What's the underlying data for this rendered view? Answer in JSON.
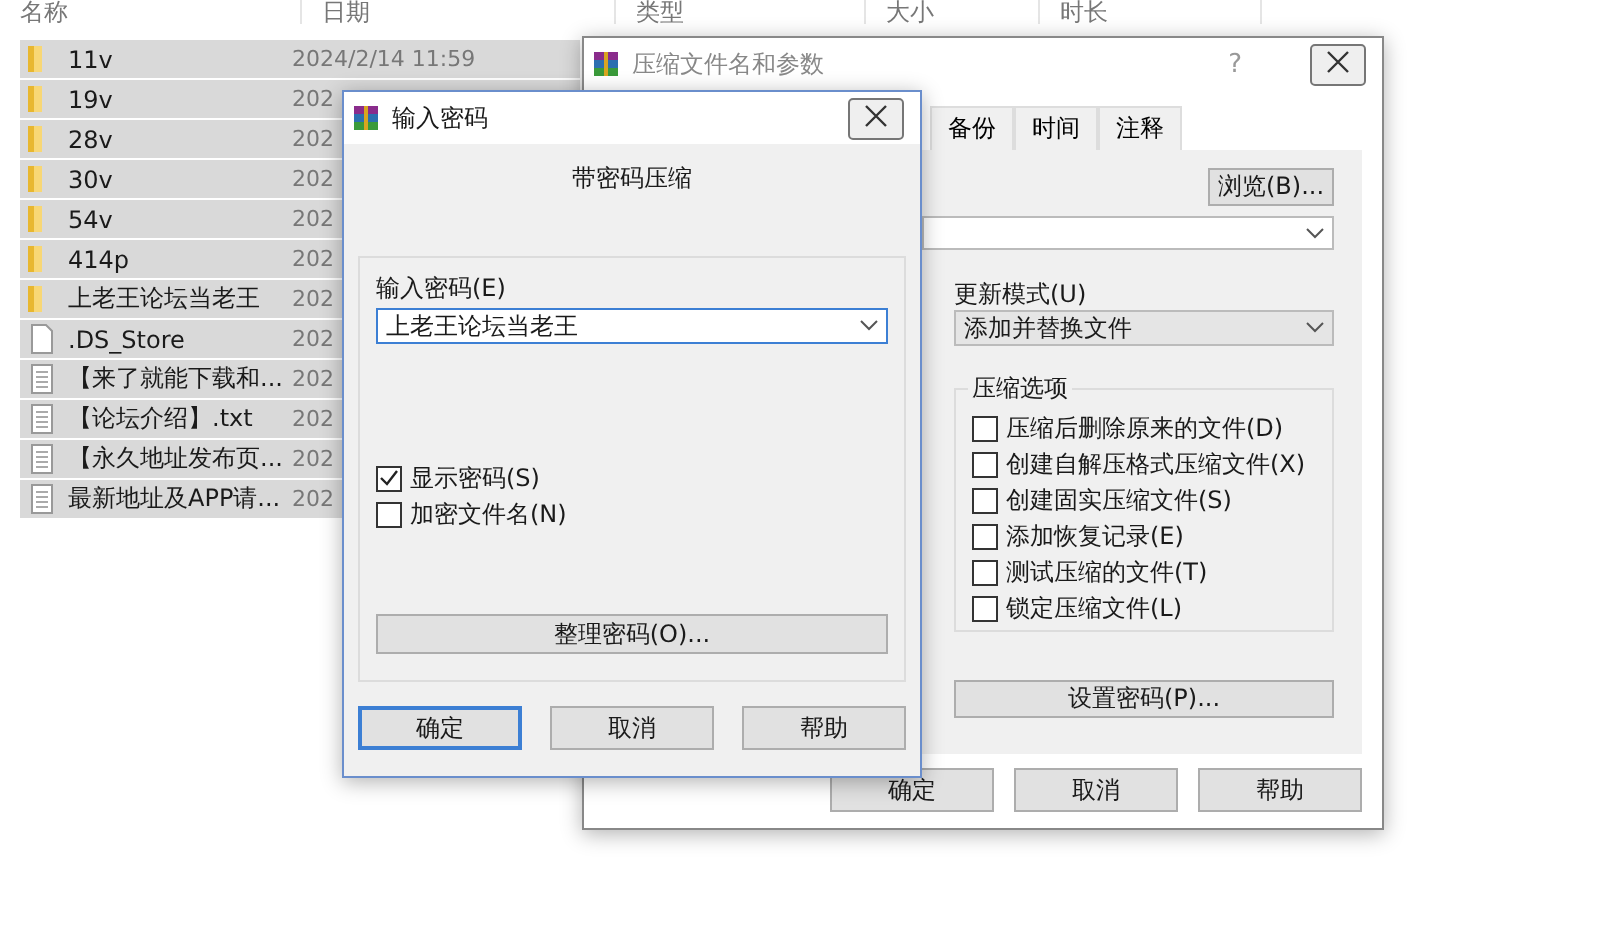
{
  "file_list": {
    "columns": [
      "名称",
      "日期",
      "类型",
      "大小",
      "时长"
    ],
    "rows": [
      {
        "name": "11v",
        "date": "2024/2/14 11:59",
        "kind": "folder",
        "selected": true
      },
      {
        "name": "19v",
        "date": "202",
        "kind": "folder",
        "selected": true
      },
      {
        "name": "28v",
        "date": "202",
        "kind": "folder",
        "selected": true
      },
      {
        "name": "30v",
        "date": "202",
        "kind": "folder",
        "selected": true
      },
      {
        "name": "54v",
        "date": "202",
        "kind": "folder",
        "selected": true
      },
      {
        "name": "414p",
        "date": "202",
        "kind": "folder",
        "selected": true
      },
      {
        "name": "上老王论坛当老王",
        "date": "202",
        "kind": "folder",
        "selected": true
      },
      {
        "name": ".DS_Store",
        "date": "202",
        "kind": "file",
        "selected": true
      },
      {
        "name": "【来了就能下载和...",
        "date": "202",
        "kind": "text",
        "selected": true
      },
      {
        "name": "【论坛介绍】.txt",
        "date": "202",
        "kind": "text",
        "selected": true
      },
      {
        "name": "【永久地址发布页...",
        "date": "202",
        "kind": "text",
        "selected": true
      },
      {
        "name": "最新地址及APP请...",
        "date": "202",
        "kind": "text",
        "selected": true
      }
    ]
  },
  "archive_dialog": {
    "title": "压缩文件名和参数",
    "help": "?",
    "tabs": [
      {
        "label": "备份",
        "selected": false
      },
      {
        "label": "时间",
        "selected": false
      },
      {
        "label": "注释",
        "selected": false
      }
    ],
    "browse_button": "浏览(B)...",
    "update_mode": {
      "label": "更新模式(U)",
      "value": "添加并替换文件"
    },
    "options": {
      "title": "压缩选项",
      "items": [
        {
          "label": "压缩后删除原来的文件(D)",
          "checked": false
        },
        {
          "label": "创建自解压格式压缩文件(X)",
          "checked": false
        },
        {
          "label": "创建固实压缩文件(S)",
          "checked": false
        },
        {
          "label": "添加恢复记录(E)",
          "checked": false
        },
        {
          "label": "测试压缩的文件(T)",
          "checked": false
        },
        {
          "label": "锁定压缩文件(L)",
          "checked": false
        }
      ]
    },
    "set_password_button": "设置密码(P)...",
    "buttons": [
      {
        "label": "确定",
        "default": false
      },
      {
        "label": "取消",
        "default": false
      },
      {
        "label": "帮助",
        "default": false
      }
    ]
  },
  "password_dialog": {
    "title": "输入密码",
    "heading": "带密码压缩",
    "password_label": "输入密码(E)",
    "password_value": "上老王论坛当老王",
    "checkboxes": [
      {
        "label": "显示密码(S)",
        "checked": true
      },
      {
        "label": "加密文件名(N)",
        "checked": false
      }
    ],
    "organize_button": "整理密码(O)...",
    "buttons": [
      {
        "label": "确定",
        "default": true
      },
      {
        "label": "取消",
        "default": false
      },
      {
        "label": "帮助",
        "default": false
      }
    ]
  }
}
